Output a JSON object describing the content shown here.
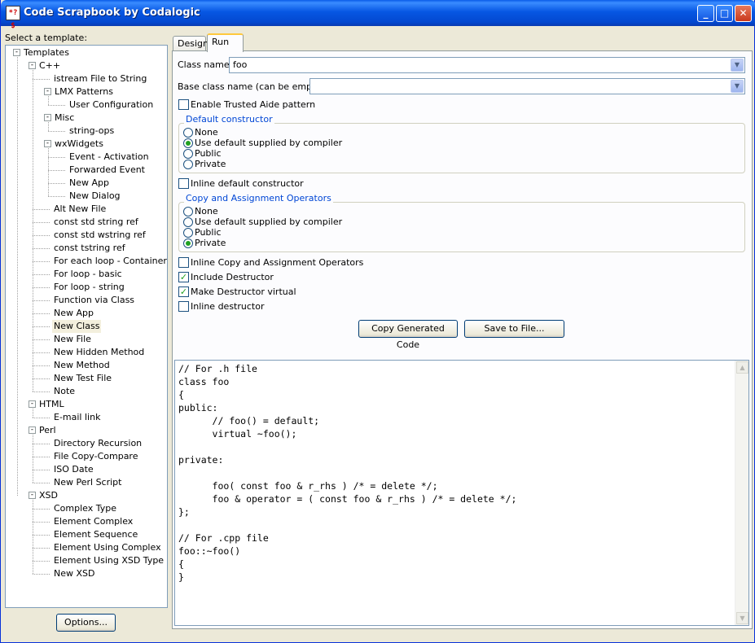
{
  "window": {
    "title": "Code Scrapbook by Codalogic",
    "app_icon_text": "*?$",
    "buttons": {
      "minimize": "_",
      "maximize": "□",
      "close": "✕"
    }
  },
  "left": {
    "select_label": "Select a template:",
    "options_button": "Options..."
  },
  "tree": [
    {
      "label": "Templates",
      "level": 0,
      "expandable": true,
      "state": "-"
    },
    {
      "label": "C++",
      "level": 1,
      "expandable": true,
      "state": "-"
    },
    {
      "label": "istream File to String",
      "level": 2
    },
    {
      "label": "LMX Patterns",
      "level": 2,
      "expandable": true,
      "state": "-"
    },
    {
      "label": "User Configuration",
      "level": 3
    },
    {
      "label": "Misc",
      "level": 2,
      "expandable": true,
      "state": "-"
    },
    {
      "label": "string-ops",
      "level": 3
    },
    {
      "label": "wxWidgets",
      "level": 2,
      "expandable": true,
      "state": "-"
    },
    {
      "label": "Event - Activation",
      "level": 3
    },
    {
      "label": "Forwarded Event",
      "level": 3
    },
    {
      "label": "New App",
      "level": 3
    },
    {
      "label": "New Dialog",
      "level": 3
    },
    {
      "label": "Alt New File",
      "level": 2
    },
    {
      "label": "const std string ref",
      "level": 2
    },
    {
      "label": "const std wstring ref",
      "level": 2
    },
    {
      "label": "const tstring ref",
      "level": 2
    },
    {
      "label": "For each loop - Container",
      "level": 2
    },
    {
      "label": "For loop - basic",
      "level": 2
    },
    {
      "label": "For loop - string",
      "level": 2
    },
    {
      "label": "Function via Class",
      "level": 2
    },
    {
      "label": "New App",
      "level": 2
    },
    {
      "label": "New Class",
      "level": 2,
      "selected": true
    },
    {
      "label": "New File",
      "level": 2
    },
    {
      "label": "New Hidden Method",
      "level": 2
    },
    {
      "label": "New Method",
      "level": 2
    },
    {
      "label": "New Test File",
      "level": 2
    },
    {
      "label": "Note",
      "level": 2
    },
    {
      "label": "HTML",
      "level": 1,
      "expandable": true,
      "state": "-"
    },
    {
      "label": "E-mail link",
      "level": 2
    },
    {
      "label": "Perl",
      "level": 1,
      "expandable": true,
      "state": "-"
    },
    {
      "label": "Directory Recursion",
      "level": 2
    },
    {
      "label": "File Copy-Compare",
      "level": 2
    },
    {
      "label": "ISO Date",
      "level": 2
    },
    {
      "label": "New Perl Script",
      "level": 2
    },
    {
      "label": "XSD",
      "level": 1,
      "expandable": true,
      "state": "-"
    },
    {
      "label": "Complex Type",
      "level": 2
    },
    {
      "label": "Element Complex",
      "level": 2
    },
    {
      "label": "Element Sequence",
      "level": 2
    },
    {
      "label": "Element Using Complex",
      "level": 2
    },
    {
      "label": "Element Using XSD Type",
      "level": 2
    },
    {
      "label": "New XSD",
      "level": 2
    }
  ],
  "tabs": [
    {
      "label": "Design",
      "active": false
    },
    {
      "label": "Run",
      "active": true
    }
  ],
  "form": {
    "class_name_label": "Class name:",
    "class_name_value": "foo",
    "base_class_label": "Base class name (can be empty):",
    "base_class_value": "",
    "enable_trusted_label": "Enable Trusted Aide pattern",
    "enable_trusted_checked": false,
    "default_ctor_group": "Default constructor",
    "default_ctor_options": [
      {
        "label": "None",
        "selected": false
      },
      {
        "label": "Use default supplied by compiler",
        "selected": true
      },
      {
        "label": "Public",
        "selected": false
      },
      {
        "label": "Private",
        "selected": false
      }
    ],
    "inline_default_ctor_label": "Inline default constructor",
    "inline_default_ctor_checked": false,
    "copy_assign_group": "Copy and Assignment Operators",
    "copy_assign_options": [
      {
        "label": "None",
        "selected": false
      },
      {
        "label": "Use default supplied by compiler",
        "selected": false
      },
      {
        "label": "Public",
        "selected": false
      },
      {
        "label": "Private",
        "selected": true
      }
    ],
    "inline_copy_label": "Inline Copy and Assignment Operators",
    "inline_copy_checked": false,
    "include_dtor_label": "Include Destructor",
    "include_dtor_checked": true,
    "virtual_dtor_label": "Make Destructor virtual",
    "virtual_dtor_checked": true,
    "inline_dtor_label": "Inline destructor",
    "inline_dtor_checked": false,
    "copy_code_button": "Copy Generated Code",
    "save_file_button": "Save to File..."
  },
  "code": [
    "// For .h file",
    "class foo",
    "{",
    "public:",
    "\t// foo() = default;",
    "\tvirtual ~foo();",
    "",
    "private:",
    "",
    "\tfoo( const foo & r_rhs ) /* = delete */;",
    "\tfoo & operator = ( const foo & r_rhs ) /* = delete */;",
    "};",
    "",
    "// For .cpp file",
    "foo::~foo()",
    "{",
    "}"
  ]
}
